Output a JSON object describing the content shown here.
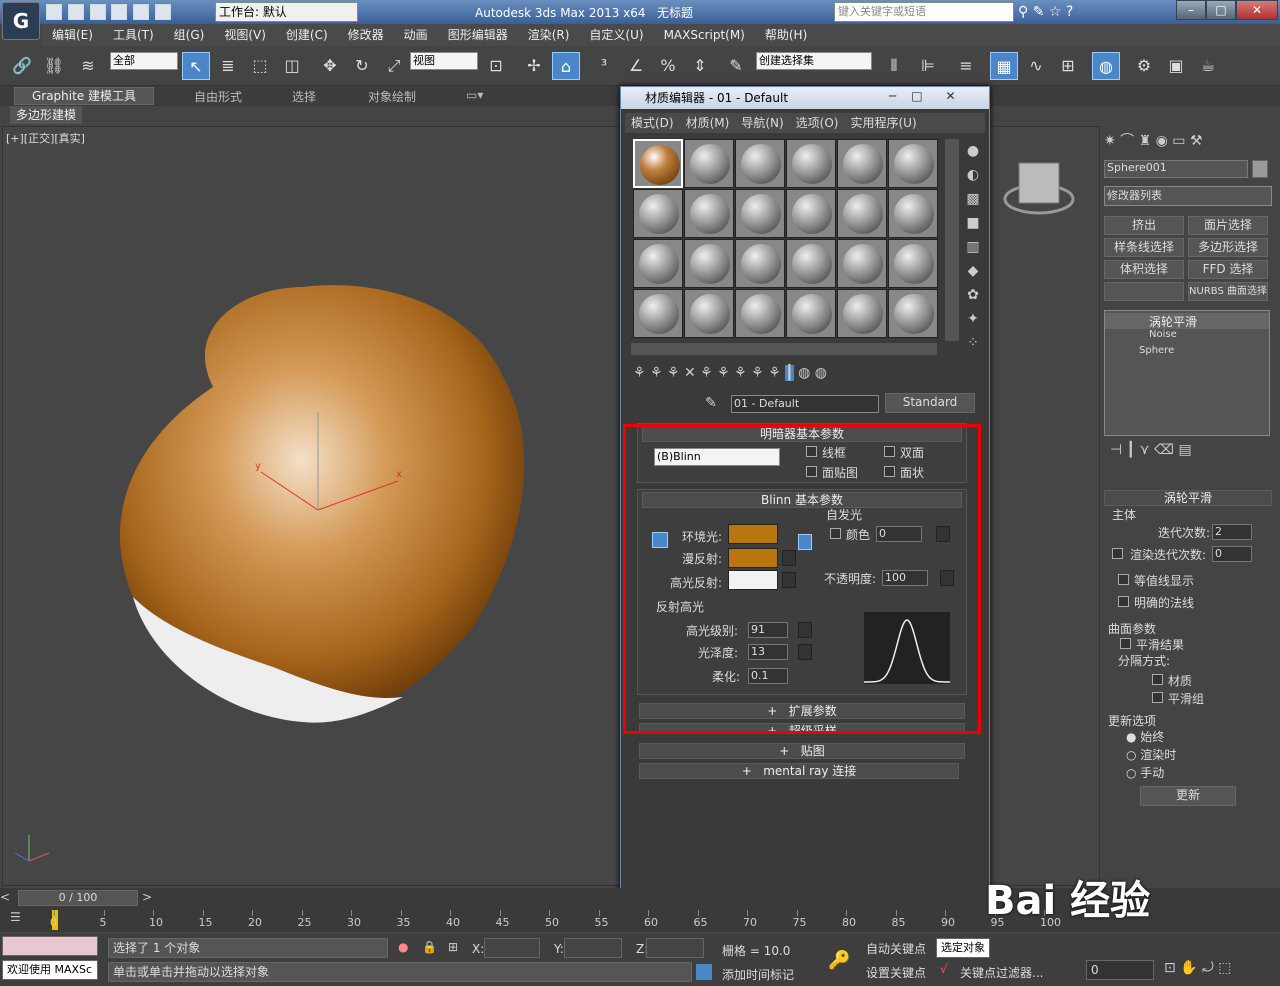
{
  "app": {
    "title": "Autodesk 3ds Max  2013 x64",
    "doc": "无标题",
    "workspace": "工作台: 默认",
    "search_placeholder": "键入关键字或短语"
  },
  "menu": [
    "编辑(E)",
    "工具(T)",
    "组(G)",
    "视图(V)",
    "创建(C)",
    "修改器",
    "动画",
    "图形编辑器",
    "渲染(R)",
    "自定义(U)",
    "MAXScript(M)",
    "帮助(H)"
  ],
  "toolbar": {
    "filter": "全部",
    "refcoord": "视图",
    "named_sel": "创建选择集"
  },
  "ribbon": [
    "Graphite 建模工具",
    "自由形式",
    "选择",
    "对象绘制"
  ],
  "subribbon": "多边形建模",
  "viewport": {
    "label": "[+][正交][真实]"
  },
  "material_editor": {
    "title": "材质编辑器 - 01 - Default",
    "menu": [
      "模式(D)",
      "材质(M)",
      "导航(N)",
      "选项(O)",
      "实用程序(U)"
    ],
    "material_name": "01 - Default",
    "material_type": "Standard",
    "shader_rollout": "明暗器基本参数",
    "shader": "(B)Blinn",
    "shader_opts": [
      "线框",
      "双面",
      "面贴图",
      "面状"
    ],
    "blinn_rollout": "Blinn 基本参数",
    "self_illum": "自发光",
    "color_label": "颜色",
    "color_value": "0",
    "ambient": "环境光:",
    "diffuse": "漫反射:",
    "specular": "高光反射:",
    "opacity_label": "不透明度:",
    "opacity_value": "100",
    "spec_group": "反射高光",
    "spec_level_label": "高光级别:",
    "spec_level": "91",
    "gloss_label": "光泽度:",
    "gloss": "13",
    "soften_label": "柔化:",
    "soften": "0.1",
    "rollouts": [
      "扩展参数",
      "超级采样",
      "贴图",
      "mental ray 连接"
    ],
    "colors": {
      "ambient": "#b87510",
      "diffuse": "#b87510",
      "specular": "#f2f2f2"
    }
  },
  "command_panel": {
    "object_name": "Sphere001",
    "modifier_list": "修改器列表",
    "buttons": [
      "挤出",
      "面片选择",
      "样条线选择",
      "多边形选择",
      "体积选择",
      "FFD 选择",
      "",
      "NURBS 曲面选择"
    ],
    "stack": [
      "涡轮平滑",
      "Noise",
      "Sphere"
    ],
    "ts_title": "涡轮平滑",
    "main": "主体",
    "iter_label": "迭代次数:",
    "iter": "2",
    "render_iter_label": "渲染迭代次数:",
    "render_iter": "0",
    "isoline": "等值线显示",
    "explicit": "明确的法线",
    "surface": "曲面参数",
    "smooth_result": "平滑结果",
    "sep": "分隔方式:",
    "material": "材质",
    "smoothing_groups": "平滑组",
    "update_opts": "更新选项",
    "always": "始终",
    "when_render": "渲染时",
    "manual": "手动",
    "update": "更新"
  },
  "timeline": {
    "frame": "0 / 100",
    "ticks": [
      "0",
      "5",
      "10",
      "15",
      "20",
      "25",
      "30",
      "35",
      "40",
      "45",
      "50",
      "55",
      "60",
      "65",
      "70",
      "75",
      "80",
      "85",
      "90",
      "95",
      "100"
    ]
  },
  "status": {
    "selected": "选择了 1 个对象",
    "hint": "单击或单击并拖动以选择对象",
    "welcome": "欢迎使用 MAXSc",
    "x": "X:",
    "y": "Y:",
    "z": "Z:",
    "grid": "栅格 = 10.0",
    "add_time_tag": "添加时间标记",
    "auto_key": "自动关键点",
    "set_key": "设置关键点",
    "sel_obj": "选定对象",
    "key_filter": "关键点过滤器...",
    "frame_field": "0"
  },
  "watermark": "Bai 经验"
}
